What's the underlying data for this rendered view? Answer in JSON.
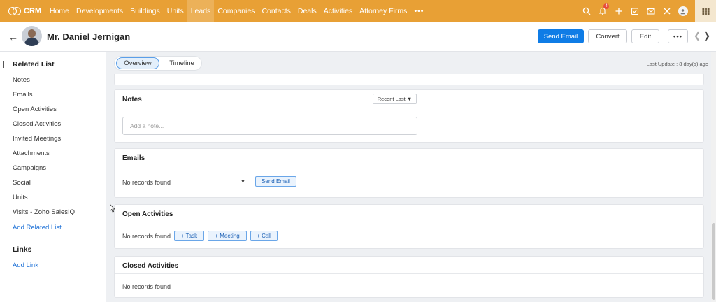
{
  "nav": {
    "brand": "CRM",
    "tabs": [
      "Home",
      "Developments",
      "Buildings",
      "Units",
      "Leads",
      "Companies",
      "Contacts",
      "Deals",
      "Activities",
      "Attorney Firms",
      "•••"
    ],
    "active_tab": "Leads",
    "notification_count": "4",
    "icons": [
      "search-icon",
      "bell-icon",
      "plus-icon",
      "calendar-icon",
      "mail-icon",
      "tools-icon",
      "user-icon",
      "apps-grid-icon"
    ]
  },
  "record": {
    "name": "Mr. Daniel Jernigan",
    "buttons": {
      "send_email": "Send Email",
      "convert": "Convert",
      "edit": "Edit",
      "more": "•••"
    }
  },
  "sidebar": {
    "related_title": "Related List",
    "items": [
      "Notes",
      "Emails",
      "Open Activities",
      "Closed Activities",
      "Invited Meetings",
      "Attachments",
      "Campaigns",
      "Social",
      "Units",
      "Visits - Zoho SalesIQ"
    ],
    "add_related": "Add Related List",
    "links_title": "Links",
    "add_link": "Add Link"
  },
  "tabs": {
    "overview": "Overview",
    "timeline": "Timeline",
    "active": "Overview"
  },
  "last_update": "Last Update : 8 day(s) ago",
  "notes": {
    "title": "Notes",
    "sort": "Recent Last",
    "placeholder": "Add a note..."
  },
  "emails": {
    "title": "Emails",
    "empty": "No records found",
    "send_email": "Send Email"
  },
  "open_activities": {
    "title": "Open Activities",
    "empty": "No records found",
    "task": "Task",
    "meeting": "Meeting",
    "call": "Call"
  },
  "closed_activities": {
    "title": "Closed Activities",
    "empty": "No records found"
  },
  "colors": {
    "nav_bg": "#e8a035",
    "primary": "#0f7ce6",
    "link": "#1a6fd6"
  }
}
